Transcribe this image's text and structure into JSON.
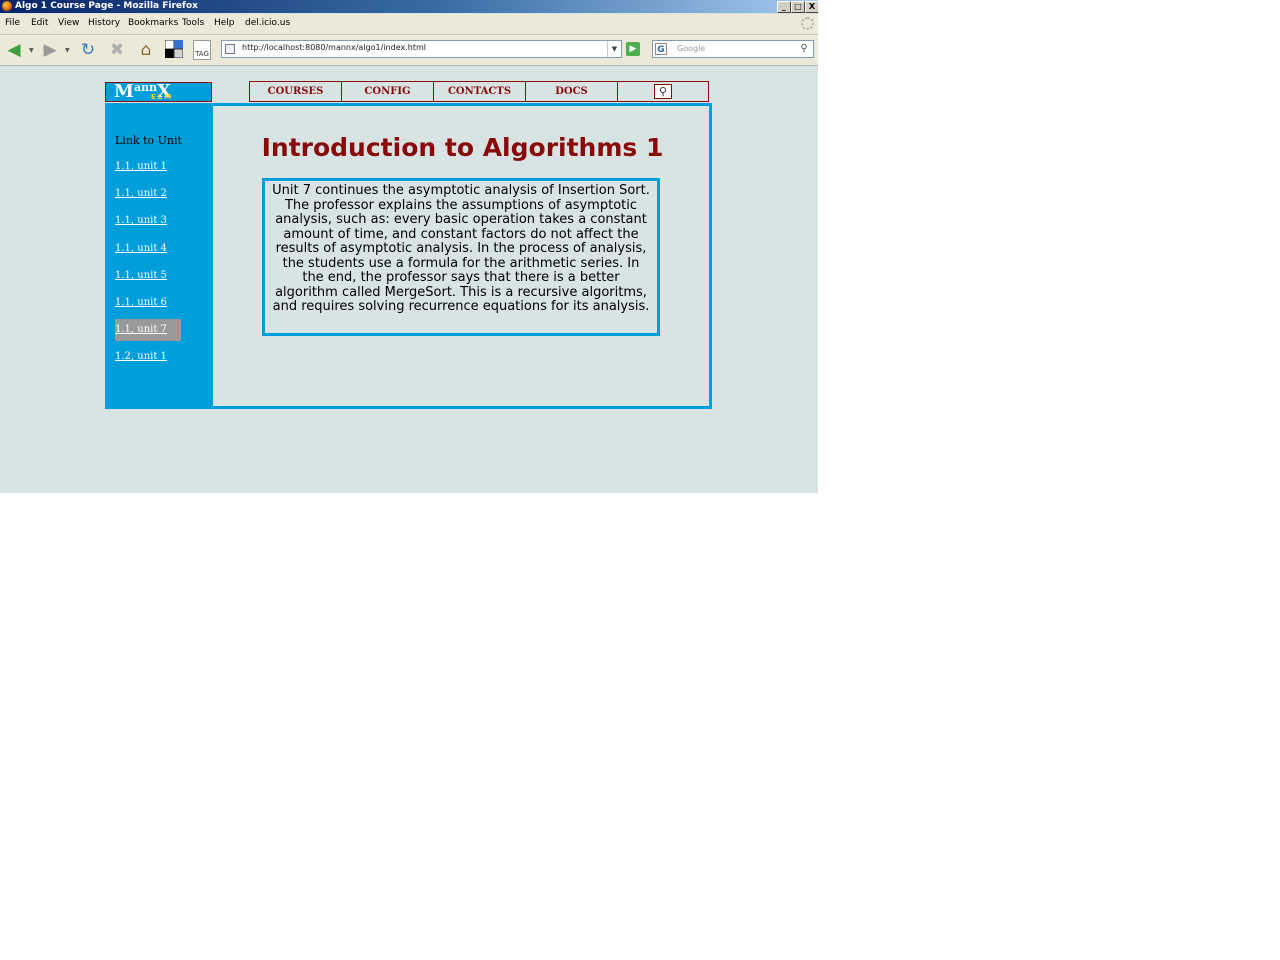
{
  "window": {
    "title": "Algo 1 Course Page - Mozilla Firefox",
    "buttons": {
      "minimize": "_",
      "maximize": "□",
      "close": "X"
    }
  },
  "menu": [
    "File",
    "Edit",
    "View",
    "History",
    "Bookmarks",
    "Tools",
    "Help",
    "del.icio.us"
  ],
  "toolbar": {
    "url": "http://localhost:8080/mannx/algo1/index.html",
    "search_placeholder": "Google",
    "tag_label": "TAG"
  },
  "site": {
    "logo": {
      "main_left": "M",
      "main_mid": "ann",
      "main_right": "X",
      "sub": "ELM"
    },
    "nav": [
      {
        "label": "COURSES"
      },
      {
        "label": "CONFIG"
      },
      {
        "label": "CONTACTS"
      },
      {
        "label": "DOCS"
      }
    ]
  },
  "sidebar": {
    "heading": "Link to Unit",
    "links": [
      {
        "label": "1.1, unit 1",
        "active": false
      },
      {
        "label": "1.1, unit 2",
        "active": false
      },
      {
        "label": "1.1, unit 3",
        "active": false
      },
      {
        "label": "1.1, unit 4",
        "active": false
      },
      {
        "label": "1.1, unit 5",
        "active": false
      },
      {
        "label": "1.1, unit 6",
        "active": false
      },
      {
        "label": "1.1, unit 7",
        "active": true
      },
      {
        "label": "1.2, unit 1",
        "active": false
      }
    ]
  },
  "main": {
    "title": "Introduction to Algorithms 1",
    "description": "Unit 7 continues the asymptotic analysis of Insertion Sort. The professor explains the assumptions of asymptotic analysis, such as: every basic operation takes a constant amount of time, and constant factors do not affect the results of asymptotic analysis. In the process of analysis, the students use a formula for the arithmetic series. In the end, the professor says that there is a better algorithm called MergeSort. This is a recursive algoritms, and requires solving recurrence equations for its analysis."
  },
  "colors": {
    "accent_blue": "#009edb",
    "title_red": "#8a0a0a",
    "page_bg": "#d8e4e4",
    "active_link_bg": "#9a9a9a"
  }
}
